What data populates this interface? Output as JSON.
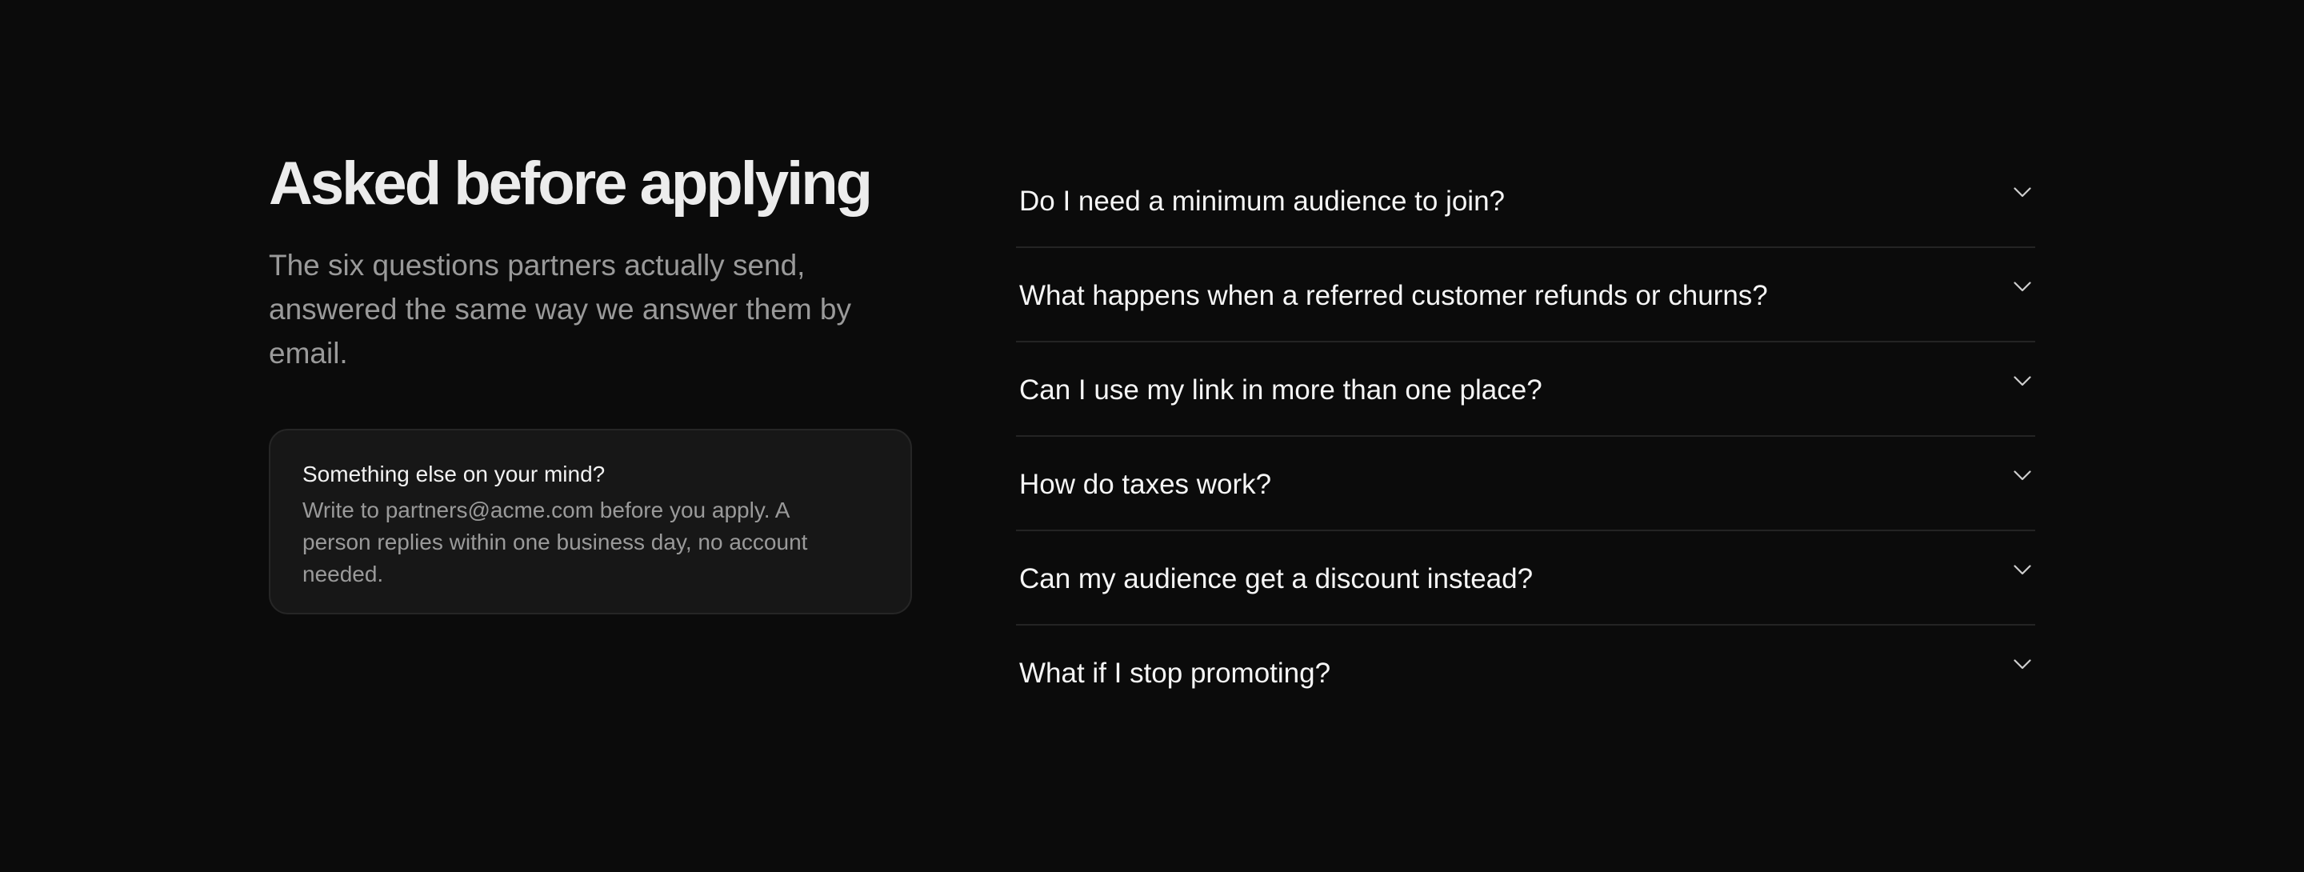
{
  "header": {
    "title": "Asked before applying",
    "subtitle": "The six questions partners actually send, answered the same way we answer them by email."
  },
  "contact_card": {
    "title": "Something else on your mind?",
    "body": "Write to partners@acme.com before you apply. A person replies within one business day, no account needed."
  },
  "faq": {
    "items": [
      {
        "question": "Do I need a minimum audience to join?",
        "icon": "chevron-down-icon"
      },
      {
        "question": "What happens when a referred customer refunds or churns?",
        "icon": "chevron-down-icon"
      },
      {
        "question": "Can I use my link in more than one place?",
        "icon": "chevron-down-icon"
      },
      {
        "question": "How do taxes work?",
        "icon": "chevron-down-icon"
      },
      {
        "question": "Can my audience get a discount instead?",
        "icon": "chevron-down-icon"
      },
      {
        "question": "What if I stop promoting?",
        "icon": "chevron-down-icon"
      }
    ]
  },
  "colors": {
    "background": "#0b0b0b",
    "card_background": "#171717",
    "muted_text": "#9a9a9a",
    "divider": "#242424"
  }
}
